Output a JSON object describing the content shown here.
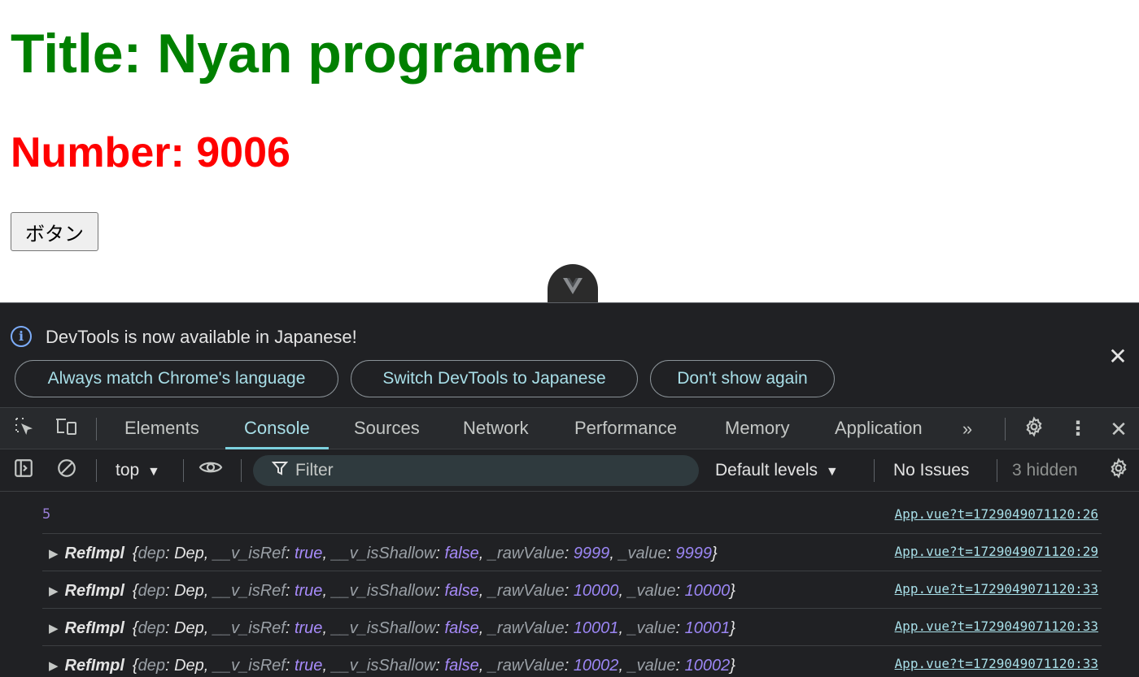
{
  "page": {
    "title": "Title: Nyan programer",
    "number": "Number: 9006",
    "button_label": "ボタン"
  },
  "devtools": {
    "infobar": {
      "message": "DevTools is now available in Japanese!",
      "buttons": [
        "Always match Chrome's language",
        "Switch DevTools to Japanese",
        "Don't show again"
      ]
    },
    "tabs": [
      "Elements",
      "Console",
      "Sources",
      "Network",
      "Performance",
      "Memory",
      "Application"
    ],
    "active_tab": "Console",
    "toolbar": {
      "context": "top",
      "filter_placeholder": "Filter",
      "levels": "Default levels",
      "issues": "No Issues",
      "hidden": "3 hidden"
    },
    "console_rows": [
      {
        "type": "number",
        "value": "5",
        "source": "App.vue?t=1729049071120:26"
      },
      {
        "type": "object",
        "class": "RefImpl",
        "dep": "Dep",
        "isRef": "true",
        "isShallow": "false",
        "rawValue": "9999",
        "value": "9999",
        "source": "App.vue?t=1729049071120:29"
      },
      {
        "type": "object",
        "class": "RefImpl",
        "dep": "Dep",
        "isRef": "true",
        "isShallow": "false",
        "rawValue": "10000",
        "value": "10000",
        "source": "App.vue?t=1729049071120:33"
      },
      {
        "type": "object",
        "class": "RefImpl",
        "dep": "Dep",
        "isRef": "true",
        "isShallow": "false",
        "rawValue": "10001",
        "value": "10001",
        "source": "App.vue?t=1729049071120:33"
      },
      {
        "type": "object",
        "class": "RefImpl",
        "dep": "Dep",
        "isRef": "true",
        "isShallow": "false",
        "rawValue": "10002",
        "value": "10002",
        "source": "App.vue?t=1729049071120:33"
      }
    ],
    "colors": {
      "title_green": "#008000",
      "number_red": "#ff0000",
      "accent_cyan": "#a8dfe8",
      "number_purple": "#9b86f4"
    }
  }
}
